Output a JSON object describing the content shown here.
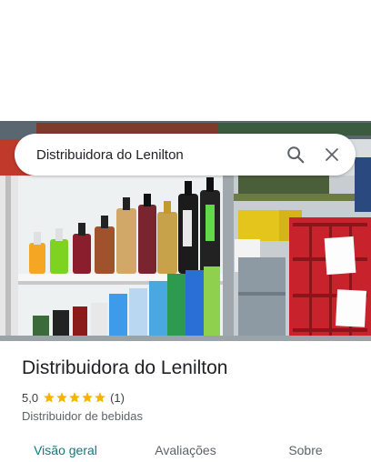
{
  "search": {
    "query": "Distribuidora do Lenilton",
    "search_icon": "search-icon",
    "close_icon": "close-icon"
  },
  "place": {
    "name": "Distribuidora do Lenilton",
    "rating": "5,0",
    "stars": 5,
    "review_count": "(1)",
    "category": "Distribuidor de bebidas"
  },
  "photo": {
    "subject": "store-shelves-photo"
  },
  "tabs": [
    {
      "label": "Visão geral",
      "active": true
    },
    {
      "label": "Avaliações",
      "active": false
    },
    {
      "label": "Sobre",
      "active": false
    }
  ],
  "colors": {
    "star": "#f4b400",
    "active_tab": "#0e7a7f",
    "crate_red": "#c8232c"
  }
}
